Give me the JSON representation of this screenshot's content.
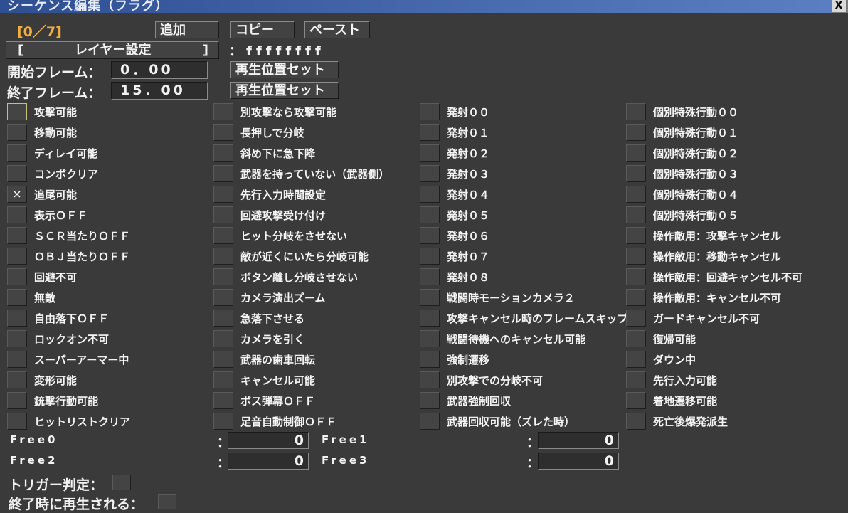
{
  "window": {
    "title": "シーケンス編集（フラグ）",
    "close_label": "X"
  },
  "toolbar": {
    "counter": "[0／7]",
    "add_label": "追加",
    "copy_label": "コピー",
    "paste_label": "ペースト"
  },
  "layer": {
    "bracket_left": "[",
    "label": "レイヤー設定",
    "bracket_right": "]",
    "flags": "：ffffffff"
  },
  "frames": {
    "start_label": "開始フレーム：",
    "start_value": "0．00",
    "start_set": "再生位置セット",
    "end_label": "終了フレーム：",
    "end_value": "15．00",
    "end_set": "再生位置セット"
  },
  "columns": [
    [
      {
        "label": "攻撃可能",
        "checked": false
      },
      {
        "label": "移動可能",
        "checked": false
      },
      {
        "label": "ディレイ可能",
        "checked": false
      },
      {
        "label": "コンボクリア",
        "checked": false
      },
      {
        "label": "追尾可能",
        "checked": true
      },
      {
        "label": "表示ＯＦＦ",
        "checked": false
      },
      {
        "label": "ＳＣＲ当たりＯＦＦ",
        "checked": false
      },
      {
        "label": "ＯＢＪ当たりＯＦＦ",
        "checked": false
      },
      {
        "label": "回避不可",
        "checked": false
      },
      {
        "label": "無敵",
        "checked": false
      },
      {
        "label": "自由落下ＯＦＦ",
        "checked": false
      },
      {
        "label": "ロックオン不可",
        "checked": false
      },
      {
        "label": "スーパーアーマー中",
        "checked": false
      },
      {
        "label": "変形可能",
        "checked": false
      },
      {
        "label": "銃撃行動可能",
        "checked": false
      },
      {
        "label": "ヒットリストクリア",
        "checked": false
      }
    ],
    [
      {
        "label": "別攻撃なら攻撃可能",
        "checked": false
      },
      {
        "label": "長押しで分岐",
        "checked": false
      },
      {
        "label": "斜め下に急下降",
        "checked": false
      },
      {
        "label": "武器を持っていない（武器側）",
        "checked": false
      },
      {
        "label": "先行入力時間設定",
        "checked": false
      },
      {
        "label": "回避攻撃受け付け",
        "checked": false
      },
      {
        "label": "ヒット分岐をさせない",
        "checked": false
      },
      {
        "label": "敵が近くにいたら分岐可能",
        "checked": false
      },
      {
        "label": "ボタン離し分岐させない",
        "checked": false
      },
      {
        "label": "カメラ演出ズーム",
        "checked": false
      },
      {
        "label": "急落下させる",
        "checked": false
      },
      {
        "label": "カメラを引く",
        "checked": false
      },
      {
        "label": "武器の歯車回転",
        "checked": false
      },
      {
        "label": "キャンセル可能",
        "checked": false
      },
      {
        "label": "ボス弾幕ＯＦＦ",
        "checked": false
      },
      {
        "label": "足音自動制御ＯＦＦ",
        "checked": false
      }
    ],
    [
      {
        "label": "発射００",
        "checked": false
      },
      {
        "label": "発射０１",
        "checked": false
      },
      {
        "label": "発射０２",
        "checked": false
      },
      {
        "label": "発射０３",
        "checked": false
      },
      {
        "label": "発射０４",
        "checked": false
      },
      {
        "label": "発射０５",
        "checked": false
      },
      {
        "label": "発射０６",
        "checked": false
      },
      {
        "label": "発射０７",
        "checked": false
      },
      {
        "label": "発射０８",
        "checked": false
      },
      {
        "label": "戦闘時モーションカメラ２",
        "checked": false
      },
      {
        "label": "攻撃キャンセル時のフレームスキップ",
        "checked": false
      },
      {
        "label": "戦闘待機へのキャンセル可能",
        "checked": false
      },
      {
        "label": "強制遷移",
        "checked": false
      },
      {
        "label": "別攻撃での分岐不可",
        "checked": false
      },
      {
        "label": "武器強制回収",
        "checked": false
      },
      {
        "label": "武器回収可能（ズレた時）",
        "checked": false
      }
    ],
    [
      {
        "label": "個別特殊行動００",
        "checked": false
      },
      {
        "label": "個別特殊行動０１",
        "checked": false
      },
      {
        "label": "個別特殊行動０２",
        "checked": false
      },
      {
        "label": "個別特殊行動０３",
        "checked": false
      },
      {
        "label": "個別特殊行動０４",
        "checked": false
      },
      {
        "label": "個別特殊行動０５",
        "checked": false
      },
      {
        "label": "操作敵用：攻撃キャンセル",
        "checked": false
      },
      {
        "label": "操作敵用：移動キャンセル",
        "checked": false
      },
      {
        "label": "操作敵用：回避キャンセル不可",
        "checked": false
      },
      {
        "label": "操作敵用：キャンセル不可",
        "checked": false
      },
      {
        "label": "ガードキャンセル不可",
        "checked": false
      },
      {
        "label": "復帰可能",
        "checked": false
      },
      {
        "label": "ダウン中",
        "checked": false
      },
      {
        "label": "先行入力可能",
        "checked": false
      },
      {
        "label": "着地遷移可能",
        "checked": false
      },
      {
        "label": "死亡後爆発派生",
        "checked": false
      }
    ]
  ],
  "free": [
    {
      "label": "Free0",
      "value": "0"
    },
    {
      "label": "Free1",
      "value": "0"
    },
    {
      "label": "Free2",
      "value": "0"
    },
    {
      "label": "Free3",
      "value": "0"
    }
  ],
  "colon": "：",
  "trigger_label": "トリガー判定：",
  "end_play_label": "終了時に再生される："
}
